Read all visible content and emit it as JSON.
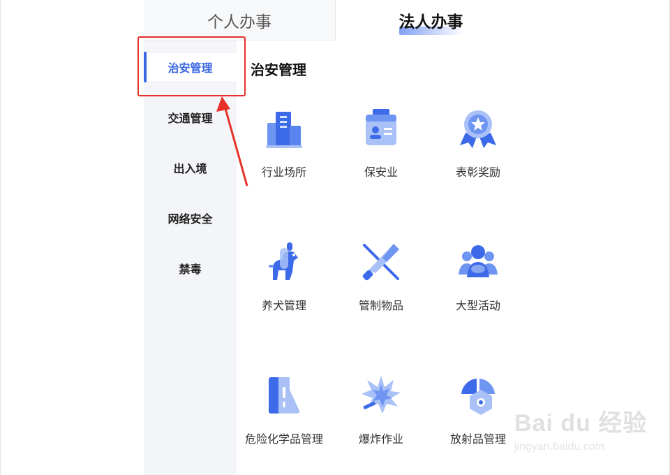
{
  "tabs": [
    {
      "label": "个人办事",
      "active": false
    },
    {
      "label": "法人办事",
      "active": true
    }
  ],
  "sidebar": {
    "items": [
      {
        "label": "治安管理",
        "active": true
      },
      {
        "label": "交通管理",
        "active": false
      },
      {
        "label": "出入境",
        "active": false
      },
      {
        "label": "网络安全",
        "active": false
      },
      {
        "label": "禁毒",
        "active": false
      }
    ]
  },
  "main": {
    "section_title": "治安管理",
    "services": [
      {
        "label": "行业场所",
        "icon": "building-icon"
      },
      {
        "label": "保安业",
        "icon": "id-card-icon"
      },
      {
        "label": "表彰奖励",
        "icon": "medal-icon"
      },
      {
        "label": "养犬管理",
        "icon": "dog-icon"
      },
      {
        "label": "管制物品",
        "icon": "knife-icon"
      },
      {
        "label": "大型活动",
        "icon": "crowd-icon"
      },
      {
        "label": "危险化学品管理",
        "icon": "flask-icon"
      },
      {
        "label": "爆炸作业",
        "icon": "explosion-icon"
      },
      {
        "label": "放射品管理",
        "icon": "radiation-icon"
      }
    ]
  },
  "annotation": {
    "color": "#e8302a"
  },
  "colors": {
    "accent": "#3a67e3",
    "icon_blue": "#3d6ae8",
    "icon_light": "#a9c1f7"
  },
  "watermark": {
    "logo": "Bai du 经验",
    "url": "jingyan.baidu.com"
  }
}
